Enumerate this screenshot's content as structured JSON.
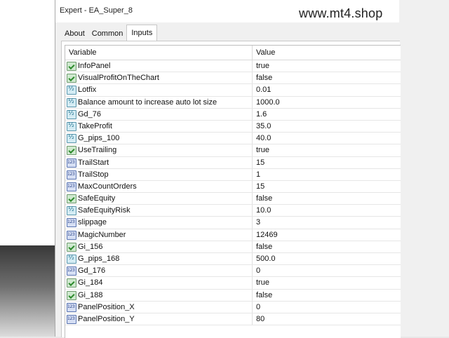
{
  "window": {
    "title": "Expert - EA_Super_8"
  },
  "watermark": "www.mt4.shop",
  "tabs": [
    {
      "label": "About"
    },
    {
      "label": "Common"
    },
    {
      "label": "Inputs",
      "active": true
    }
  ],
  "table": {
    "headers": {
      "variable": "Variable",
      "value": "Value"
    },
    "rows": [
      {
        "name": "InfoPanel",
        "value": "true",
        "icon": "bool-icon"
      },
      {
        "name": "VisualProfitOnTheChart",
        "value": "false",
        "icon": "bool-icon"
      },
      {
        "name": "Lotfix",
        "value": "0.01",
        "icon": "double-icon"
      },
      {
        "name": "Balance amount to increase auto lot size",
        "value": "1000.0",
        "icon": "double-icon"
      },
      {
        "name": "Gd_76",
        "value": "1.6",
        "icon": "double-icon"
      },
      {
        "name": "TakeProfit",
        "value": "35.0",
        "icon": "double-icon"
      },
      {
        "name": "G_pips_100",
        "value": "40.0",
        "icon": "double-icon"
      },
      {
        "name": "UseTrailing",
        "value": "true",
        "icon": "bool-icon"
      },
      {
        "name": "TrailStart",
        "value": "15",
        "icon": "int-icon"
      },
      {
        "name": "TrailStop",
        "value": "1",
        "icon": "int-icon"
      },
      {
        "name": "MaxCountOrders",
        "value": "15",
        "icon": "int-icon"
      },
      {
        "name": "SafeEquity",
        "value": "false",
        "icon": "bool-icon"
      },
      {
        "name": "SafeEquityRisk",
        "value": "10.0",
        "icon": "double-icon"
      },
      {
        "name": "slippage",
        "value": "3",
        "icon": "int-icon"
      },
      {
        "name": "MagicNumber",
        "value": "12469",
        "icon": "int-icon"
      },
      {
        "name": "Gi_156",
        "value": "false",
        "icon": "bool-icon"
      },
      {
        "name": "G_pips_168",
        "value": "500.0",
        "icon": "double-icon"
      },
      {
        "name": "Gd_176",
        "value": "0",
        "icon": "int-icon"
      },
      {
        "name": "Gi_184",
        "value": "true",
        "icon": "bool-icon"
      },
      {
        "name": "Gi_188",
        "value": "false",
        "icon": "bool-icon"
      },
      {
        "name": "PanelPosition_X",
        "value": "0",
        "icon": "int-icon"
      },
      {
        "name": "PanelPosition_Y",
        "value": "80",
        "icon": "int-icon"
      }
    ]
  }
}
